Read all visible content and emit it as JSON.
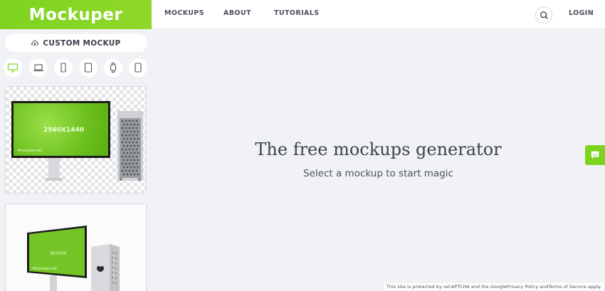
{
  "brand": {
    "name": "Mockuper",
    "color": "#7ed321"
  },
  "sidebar": {
    "custom_button": {
      "label": "CUSTOM MOCKUP",
      "icon": "upload-cloud-icon"
    },
    "device_filters": [
      {
        "name": "desktop-filter",
        "icon": "monitor-icon",
        "active": true
      },
      {
        "name": "laptop-filter",
        "icon": "laptop-icon"
      },
      {
        "name": "phone-filter",
        "icon": "phone-icon"
      },
      {
        "name": "tablet-filter",
        "icon": "tablet-icon"
      },
      {
        "name": "watch-filter",
        "icon": "watch-icon"
      },
      {
        "name": "other-filter",
        "icon": "device-frame-icon"
      }
    ],
    "mockups": [
      {
        "resolution": "2560X1440",
        "watermark": "Mockuper.net"
      },
      {
        "resolution": "5K3504",
        "watermark": "Mockuper.net"
      }
    ]
  },
  "nav": {
    "items": [
      "MOCKUPS",
      "ABOUT",
      "TUTORIALS"
    ],
    "login": "LOGIN",
    "search_icon": "search-icon"
  },
  "main": {
    "title": "The free mockups generator",
    "subtitle": "Select a mockup to start magic"
  },
  "chat": {
    "icon": "chat-icon"
  },
  "recaptcha": "This site is protected by reCAPTCHA and the GooglePrivacy Policy andTerms of Service apply."
}
